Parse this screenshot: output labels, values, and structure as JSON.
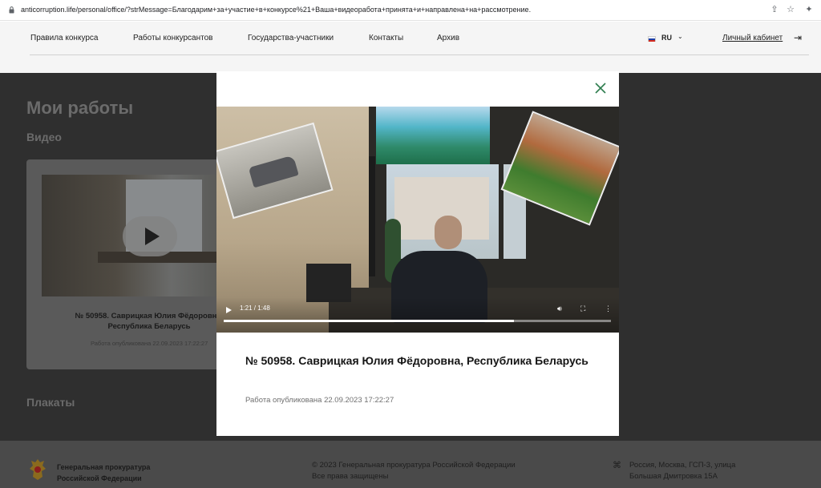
{
  "browser": {
    "url": "anticorruption.life/personal/office/?strMessage=Благодарим+за+участие+в+конкурсе%21+Ваша+видеоработа+принята+и+направлена+на+рассмотрение.",
    "icons": [
      "share-icon",
      "star-icon",
      "extensions-icon"
    ]
  },
  "nav": {
    "items": [
      {
        "label": "Правила конкурса"
      },
      {
        "label": "Работы конкурсантов"
      },
      {
        "label": "Государства-участники"
      },
      {
        "label": "Контакты"
      },
      {
        "label": "Архив"
      }
    ],
    "language": "RU",
    "cabinet": "Личный кабинет"
  },
  "page": {
    "title": "Мои работы",
    "video_section": "Видео",
    "posters_section": "Плакаты"
  },
  "card": {
    "title": "№ 50958. Саврицкая Юлия Фёдоровна, Республика Беларусь",
    "date": "Работа опубликована 22.09.2023 17:22:27"
  },
  "modal": {
    "title": "№ 50958. Саврицкая Юлия Фёдоровна, Республика Беларусь",
    "date": "Работа опубликована 22.09.2023 17:22:27",
    "player": {
      "time": "1:21 / 1:48",
      "progress": 0.75
    }
  },
  "footer": {
    "org_line1": "Генеральная прокуратура",
    "org_line2": "Российской Федерации",
    "copyright": "© 2023 Генеральная прокуратура Российской Федерации",
    "rights": "Все права защищены",
    "address_line1": "Россия, Москва, ГСП-3, улица",
    "address_line2": "Большая Дмитровка 15А"
  },
  "colors": {
    "overlay": "#2f2f2f",
    "modal": "#ffffff",
    "close_icon": "#2f7d4f",
    "footer": "#4a4a4a"
  }
}
